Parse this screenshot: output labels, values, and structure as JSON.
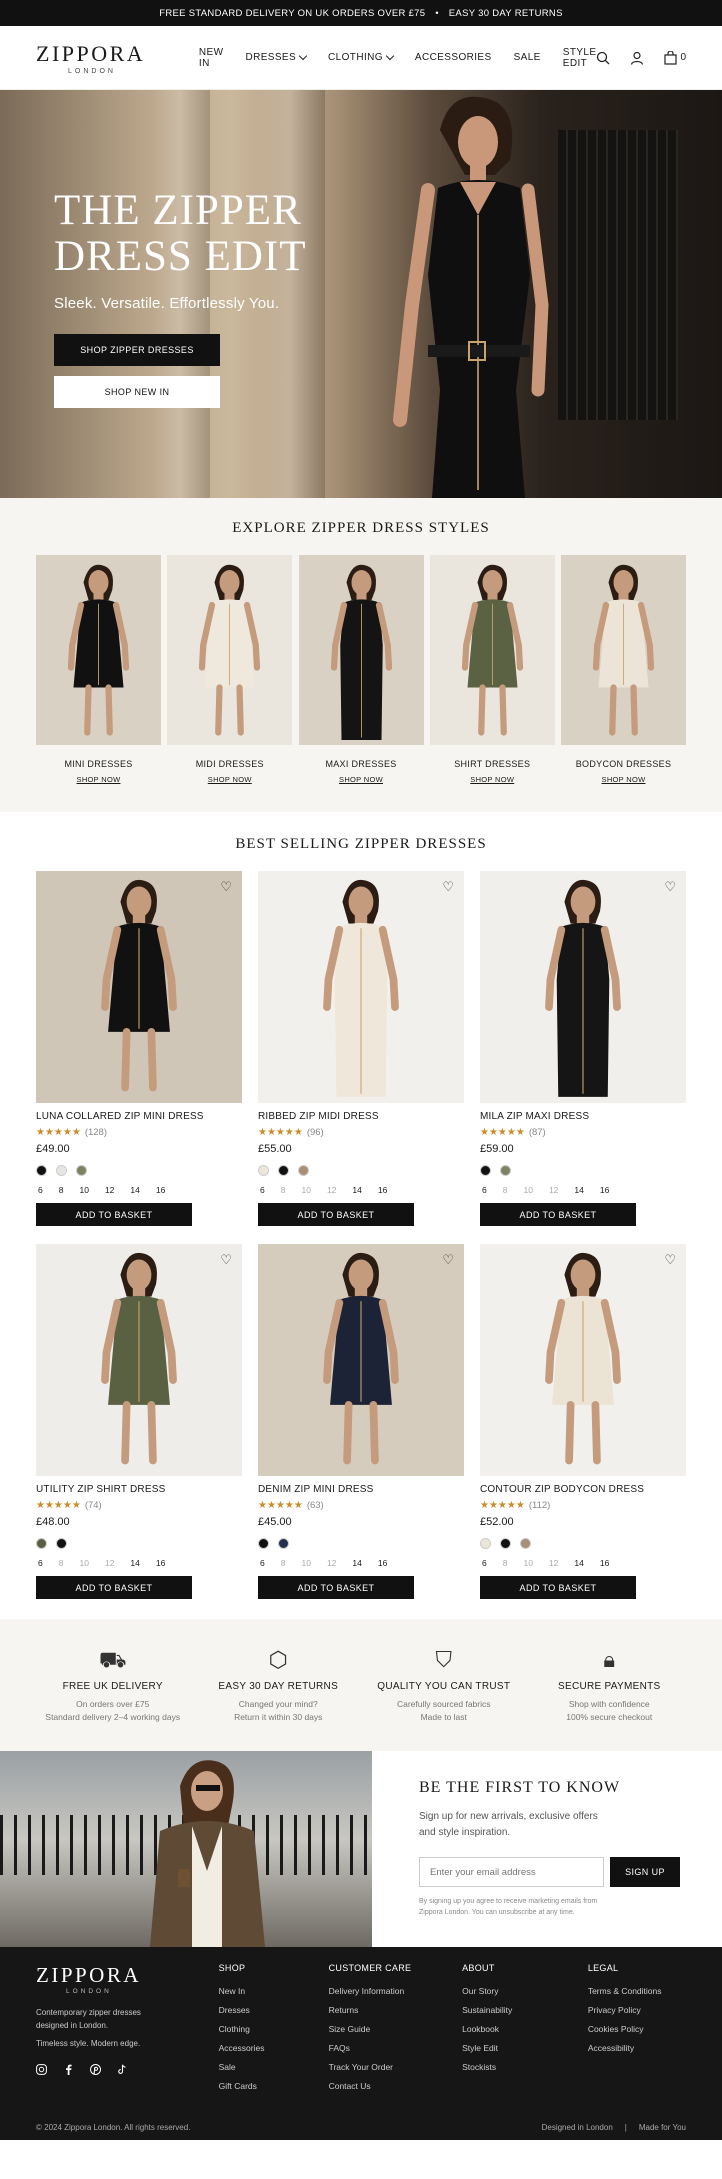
{
  "announcement": {
    "left": "FREE STANDARD DELIVERY ON UK ORDERS OVER £75",
    "sep": "•",
    "right": "EASY 30 DAY RETURNS"
  },
  "header": {
    "logo": "ZIPPORA",
    "logo_sub": "LONDON",
    "nav": [
      "NEW IN",
      "DRESSES",
      "CLOTHING",
      "ACCESSORIES",
      "SALE",
      "STYLE EDIT"
    ],
    "basket_count": "0",
    "icons": [
      "search-icon",
      "account-icon",
      "bag-icon"
    ]
  },
  "hero": {
    "title": "THE ZIPPER DRESS EDIT",
    "subtitle": "Sleek. Versatile. Effortlessly You.",
    "primary_cta": "SHOP ZIPPER DRESSES",
    "secondary_cta": "SHOP NEW IN"
  },
  "styles": {
    "title": "EXPLORE ZIPPER DRESS STYLES",
    "items": [
      {
        "label": "MINI DRESSES",
        "cta": "SHOP NOW",
        "color": "#111111"
      },
      {
        "label": "MIDI DRESSES",
        "cta": "SHOP NOW",
        "color": "#efe9dd"
      },
      {
        "label": "MAXI DRESSES",
        "cta": "SHOP NOW",
        "color": "#141414"
      },
      {
        "label": "SHIRT DRESSES",
        "cta": "SHOP NOW",
        "color": "#5b6243"
      },
      {
        "label": "BODYCON DRESSES",
        "cta": "SHOP NOW",
        "color": "#ece4d6"
      }
    ]
  },
  "best": {
    "title": "BEST SELLING ZIPPER DRESSES",
    "add_label": "ADD TO BASKET",
    "products": [
      {
        "name": "LUNA COLLARED ZIP MINI DRESS",
        "stars": "★★★★★",
        "reviews": "(128)",
        "price": "£49.00",
        "dress": "#111111",
        "bg": "#cfc6b8",
        "swatches": [
          "#111111",
          "#e8e6e2",
          "#7d8260"
        ],
        "sizes": [
          "6",
          "8",
          "10",
          "12",
          "14",
          "16"
        ],
        "unavailable": []
      },
      {
        "name": "RIBBED ZIP MIDI DRESS",
        "stars": "★★★★★",
        "reviews": "(96)",
        "price": "£55.00",
        "dress": "#efe8da",
        "bg": "#f2f0ec",
        "swatches": [
          "#ece6da",
          "#111111",
          "#a88f76"
        ],
        "sizes": [
          "6",
          "8",
          "10",
          "12",
          "14",
          "16"
        ],
        "unavailable": [
          "8",
          "10",
          "12"
        ]
      },
      {
        "name": "MILA ZIP MAXI DRESS",
        "stars": "★★★★★",
        "reviews": "(87)",
        "price": "£59.00",
        "dress": "#151515",
        "bg": "#f1efec",
        "swatches": [
          "#111111",
          "#7d8260"
        ],
        "sizes": [
          "6",
          "8",
          "10",
          "12",
          "14",
          "16"
        ],
        "unavailable": [
          "8",
          "10",
          "12"
        ]
      },
      {
        "name": "UTILITY ZIP SHIRT DRESS",
        "stars": "★★★★★",
        "reviews": "(74)",
        "price": "£48.00",
        "dress": "#5a6143",
        "bg": "#efedea",
        "swatches": [
          "#5a6143",
          "#111111"
        ],
        "sizes": [
          "6",
          "8",
          "10",
          "12",
          "14",
          "16"
        ],
        "unavailable": [
          "8",
          "10",
          "12"
        ]
      },
      {
        "name": "DENIM ZIP MINI DRESS",
        "stars": "★★★★★",
        "reviews": "(63)",
        "price": "£45.00",
        "dress": "#1c2336",
        "bg": "#d6ccbd",
        "swatches": [
          "#111111",
          "#25304f"
        ],
        "sizes": [
          "6",
          "8",
          "10",
          "12",
          "14",
          "16"
        ],
        "unavailable": [
          "8",
          "10",
          "12"
        ]
      },
      {
        "name": "CONTOUR ZIP BODYCON DRESS",
        "stars": "★★★★★",
        "reviews": "(112)",
        "price": "£52.00",
        "dress": "#ebe3d4",
        "bg": "#f2f0ec",
        "swatches": [
          "#ece6da",
          "#111111",
          "#a88f76"
        ],
        "sizes": [
          "6",
          "8",
          "10",
          "12",
          "14",
          "16"
        ],
        "unavailable": [
          "8",
          "10",
          "12"
        ]
      }
    ]
  },
  "features": [
    {
      "icon": "truck-icon",
      "glyph": "⛟",
      "title": "FREE UK DELIVERY",
      "line1": "On orders over £75",
      "line2": "Standard delivery 2–4 working days"
    },
    {
      "icon": "box-icon",
      "glyph": "⬡",
      "title": "EASY 30 DAY RETURNS",
      "line1": "Changed your mind?",
      "line2": "Return it within 30 days"
    },
    {
      "icon": "shield-icon",
      "glyph": "⛉",
      "title": "QUALITY YOU CAN TRUST",
      "line1": "Carefully sourced fabrics",
      "line2": "Made to last"
    },
    {
      "icon": "lock-icon",
      "glyph": "🔒︎",
      "title": "SECURE PAYMENTS",
      "line1": "Shop with confidence",
      "line2": "100% secure checkout"
    }
  ],
  "newsletter": {
    "title": "BE THE FIRST TO KNOW",
    "text": "Sign up for new arrivals, exclusive offers and style inspiration.",
    "placeholder": "Enter your email address",
    "button": "SIGN UP",
    "fine": "By signing up you agree to receive marketing emails from Zippora London. You can unsubscribe at any time."
  },
  "footer": {
    "logo": "ZIPPORA",
    "logo_sub": "LONDON",
    "about_line1": "Contemporary zipper dresses designed in London.",
    "about_line2": "Timeless style. Modern edge.",
    "social": [
      "instagram-icon",
      "facebook-icon",
      "pinterest-icon",
      "tiktok-icon"
    ],
    "columns": [
      {
        "title": "SHOP",
        "items": [
          "New In",
          "Dresses",
          "Clothing",
          "Accessories",
          "Sale",
          "Gift Cards"
        ]
      },
      {
        "title": "CUSTOMER CARE",
        "items": [
          "Delivery Information",
          "Returns",
          "Size Guide",
          "FAQs",
          "Track Your Order",
          "Contact Us"
        ]
      },
      {
        "title": "ABOUT",
        "items": [
          "Our Story",
          "Sustainability",
          "Lookbook",
          "Style Edit",
          "Stockists"
        ]
      },
      {
        "title": "LEGAL",
        "items": [
          "Terms & Conditions",
          "Privacy Policy",
          "Cookies Policy",
          "Accessibility"
        ]
      }
    ],
    "copyright": "© 2024 Zippora London. All rights reserved.",
    "bottom_right": [
      "Designed in London",
      "|",
      "Made for You"
    ]
  }
}
